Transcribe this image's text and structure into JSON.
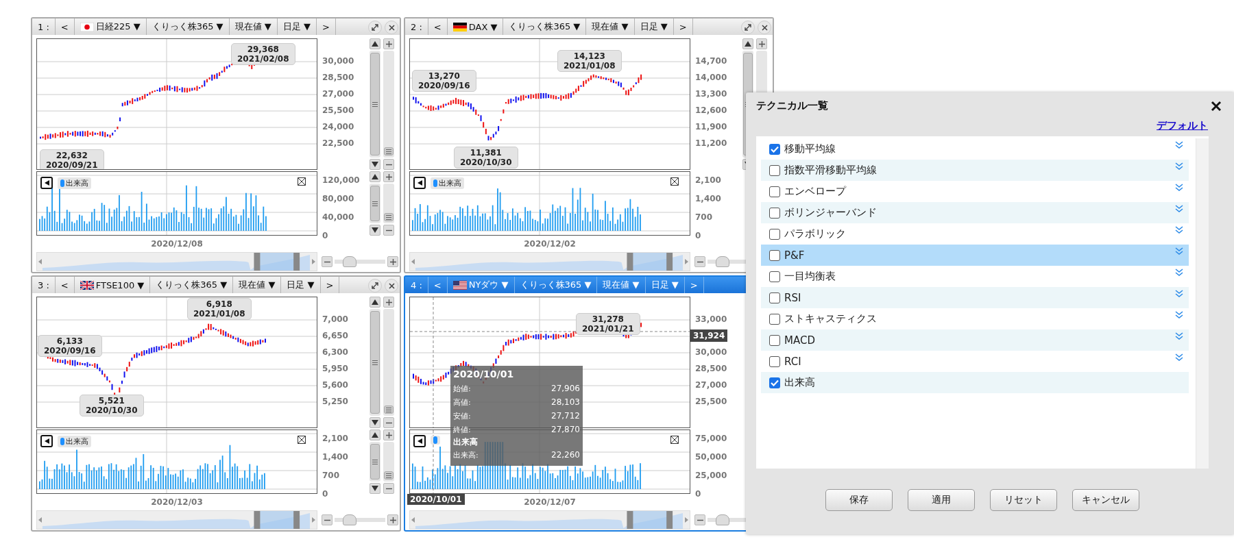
{
  "panels": [
    {
      "number": "1 :",
      "prev": "<",
      "symbol": "日経225 ▼",
      "market": "くりっく株365 ▼",
      "price_type": "現在値 ▼",
      "period": "日足 ▼",
      "next": ">",
      "selected": false,
      "controls": true,
      "price_axis": [
        "30,000",
        "28,500",
        "27,000",
        "25,500",
        "24,000",
        "22,500"
      ],
      "callouts": [
        {
          "value": "29,368",
          "date": "2021/02/08"
        },
        {
          "value": "22,632",
          "date": "2020/09/21"
        }
      ],
      "volume_legend": "出来高",
      "volume_axis": [
        "120,000",
        "80,000",
        "40,000",
        "0"
      ],
      "date_label": "2020/12/08",
      "volume_controls": true
    },
    {
      "number": "2 :",
      "prev": "<",
      "symbol": "DAX ▼",
      "market": "くりっく株365 ▼",
      "price_type": "現在値 ▼",
      "period": "日足 ▼",
      "next": ">",
      "selected": false,
      "controls": true,
      "price_axis": [
        "14,700",
        "14,000",
        "13,300",
        "12,600",
        "11,900",
        "11,200"
      ],
      "callouts": [
        {
          "value": "13,270",
          "date": "2020/09/16"
        },
        {
          "value": "11,381",
          "date": "2020/10/30"
        },
        {
          "value": "14,123",
          "date": "2021/01/08"
        }
      ],
      "volume_legend": "出来高",
      "volume_axis": [
        "2,100",
        "1,400",
        "700",
        "0"
      ],
      "date_label": "2020/12/02",
      "volume_controls": false
    },
    {
      "number": "3 :",
      "prev": "<",
      "symbol": "FTSE100 ▼",
      "market": "くりっく株365 ▼",
      "price_type": "現在値 ▼",
      "period": "日足 ▼",
      "next": ">",
      "selected": false,
      "controls": true,
      "price_axis": [
        "7,000",
        "6,650",
        "6,300",
        "5,950",
        "5,600",
        "5,250"
      ],
      "callouts": [
        {
          "value": "6,918",
          "date": "2021/01/08"
        },
        {
          "value": "6,133",
          "date": "2020/09/16"
        },
        {
          "value": "5,521",
          "date": "2020/10/30"
        }
      ],
      "volume_legend": "出来高",
      "volume_axis": [
        "2,100",
        "1,400",
        "700",
        "0"
      ],
      "date_label": "2020/12/03",
      "volume_controls": true
    },
    {
      "number": "4 :",
      "prev": "<",
      "symbol": "NYダウ ▼",
      "market": "くりっく株365 ▼",
      "price_type": "現在値 ▼",
      "period": "日足 ▼",
      "next": ">",
      "selected": true,
      "controls": false,
      "price_axis": [
        "33,000",
        "30,000",
        "28,500",
        "27,000",
        "25,500"
      ],
      "callouts": [
        {
          "value": "31,278",
          "date": "2021/01/21"
        }
      ],
      "volume_axis": [
        "75,000",
        "50,000",
        "25,000",
        "0"
      ],
      "date_label": "2020/12/07",
      "volume_controls": false,
      "crosshair": {
        "price": "31,924",
        "date": "2020/10/01"
      },
      "tooltip": {
        "date": "2020/10/01",
        "rows": [
          {
            "label": "始値:",
            "value": "27,906"
          },
          {
            "label": "高値:",
            "value": "28,103"
          },
          {
            "label": "安値:",
            "value": "27,712"
          },
          {
            "label": "終値:",
            "value": "27,870"
          }
        ],
        "section": "出来高",
        "volume_rows": [
          {
            "label": "出来高:",
            "value": "22,260"
          }
        ]
      }
    }
  ],
  "dialog": {
    "title": "テクニカル一覧",
    "default_link": "デフォルト",
    "items": [
      {
        "label": "移動平均線",
        "checked": true,
        "selected": false,
        "expandable": true
      },
      {
        "label": "指数平滑移動平均線",
        "checked": false,
        "selected": false,
        "expandable": true
      },
      {
        "label": "エンベロープ",
        "checked": false,
        "selected": false,
        "expandable": true
      },
      {
        "label": "ボリンジャーバンド",
        "checked": false,
        "selected": false,
        "expandable": true
      },
      {
        "label": "パラボリック",
        "checked": false,
        "selected": false,
        "expandable": true
      },
      {
        "label": "P&F",
        "checked": false,
        "selected": true,
        "expandable": true
      },
      {
        "label": "一目均衡表",
        "checked": false,
        "selected": false,
        "expandable": true
      },
      {
        "label": "RSI",
        "checked": false,
        "selected": false,
        "expandable": true
      },
      {
        "label": "ストキャスティクス",
        "checked": false,
        "selected": false,
        "expandable": true
      },
      {
        "label": "MACD",
        "checked": false,
        "selected": false,
        "expandable": true
      },
      {
        "label": "RCI",
        "checked": false,
        "selected": false,
        "expandable": true
      },
      {
        "label": "出来高",
        "checked": true,
        "selected": false,
        "expandable": false
      }
    ],
    "buttons": [
      "保存",
      "適用",
      "リセット",
      "キャンセル"
    ]
  }
}
